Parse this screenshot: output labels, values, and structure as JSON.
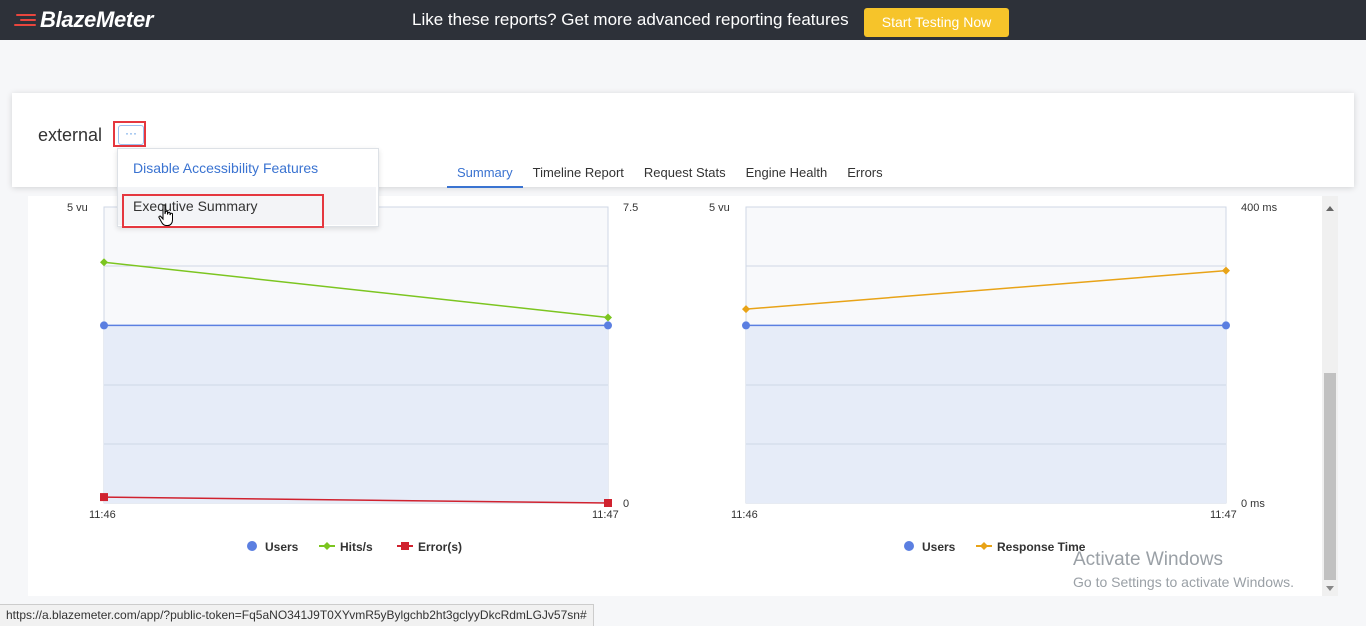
{
  "topbar": {
    "logo_text": "BlazeMeter",
    "promo_text": "Like these reports? Get more advanced reporting features",
    "cta_label": "Start Testing Now"
  },
  "header": {
    "title": "external",
    "more_button": "···"
  },
  "tabs": [
    {
      "label": "Summary",
      "active": true
    },
    {
      "label": "Timeline Report",
      "active": false
    },
    {
      "label": "Request Stats",
      "active": false
    },
    {
      "label": "Engine Health",
      "active": false
    },
    {
      "label": "Errors",
      "active": false
    }
  ],
  "dropdown": {
    "items": [
      "Disable Accessibility Features",
      "Executive Summary"
    ]
  },
  "colors": {
    "users": "#5b7fe1",
    "hits": "#7cc520",
    "errors": "#d0222f",
    "response_time": "#e8a317",
    "highlight": "#e5373f"
  },
  "chart_data": [
    {
      "type": "line",
      "x": [
        "11:46",
        "11:47"
      ],
      "y_left_ticks": [
        "5 vu"
      ],
      "y_right_ticks": [
        "7.5",
        "0"
      ],
      "ylim_left": [
        0,
        5
      ],
      "ylim_right": [
        0,
        7.5
      ],
      "series": [
        {
          "name": "Users",
          "axis": "left",
          "values": [
            3,
            3
          ],
          "area": true
        },
        {
          "name": "Hits/s",
          "axis": "right",
          "values": [
            6.1,
            4.7
          ]
        },
        {
          "name": "Error(s)",
          "axis": "right",
          "values": [
            0.15,
            0
          ]
        }
      ],
      "legend_position": "bottom-center"
    },
    {
      "type": "line",
      "x": [
        "11:46",
        "11:47"
      ],
      "y_left_ticks": [
        "5 vu"
      ],
      "y_right_ticks": [
        "400 ms",
        "0 ms"
      ],
      "ylim_left": [
        0,
        5
      ],
      "ylim_right": [
        0,
        400
      ],
      "series": [
        {
          "name": "Users",
          "axis": "left",
          "values": [
            3,
            3
          ],
          "area": true
        },
        {
          "name": "Response Time",
          "axis": "right",
          "values": [
            262,
            314
          ]
        }
      ],
      "legend_position": "bottom-center"
    }
  ],
  "watermark": {
    "line1": "Activate Windows",
    "line2": "Go to Settings to activate Windows."
  },
  "status_url": "https://a.blazemeter.com/app/?public-token=Fq5aNO341J9T0XYvmR5yBylgchb2ht3gclyyDkcRdmLGJv57sn#"
}
